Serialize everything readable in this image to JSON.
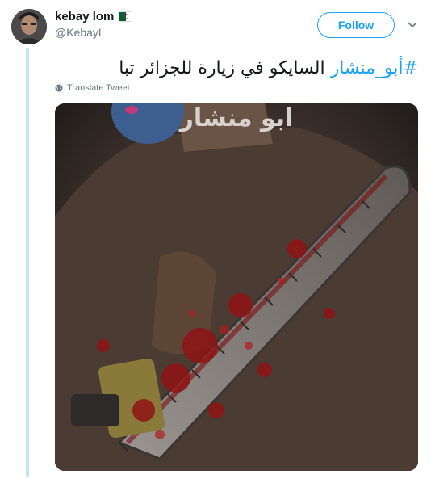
{
  "user": {
    "display_name": "kebay lom",
    "handle": "@KebayL",
    "flag_icon": "algeria-flag-icon"
  },
  "follow_label": "Follow",
  "tweet": {
    "hashtag": "#أبو_منشار",
    "text": " السايكو في زيارة للجزائر تبا"
  },
  "translate_label": "Translate Tweet",
  "media": {
    "overlay_text": "ابو منشار"
  },
  "colors": {
    "accent": "#1da1f2",
    "thread_line": "#c4e4f7",
    "muted": "#657786"
  }
}
